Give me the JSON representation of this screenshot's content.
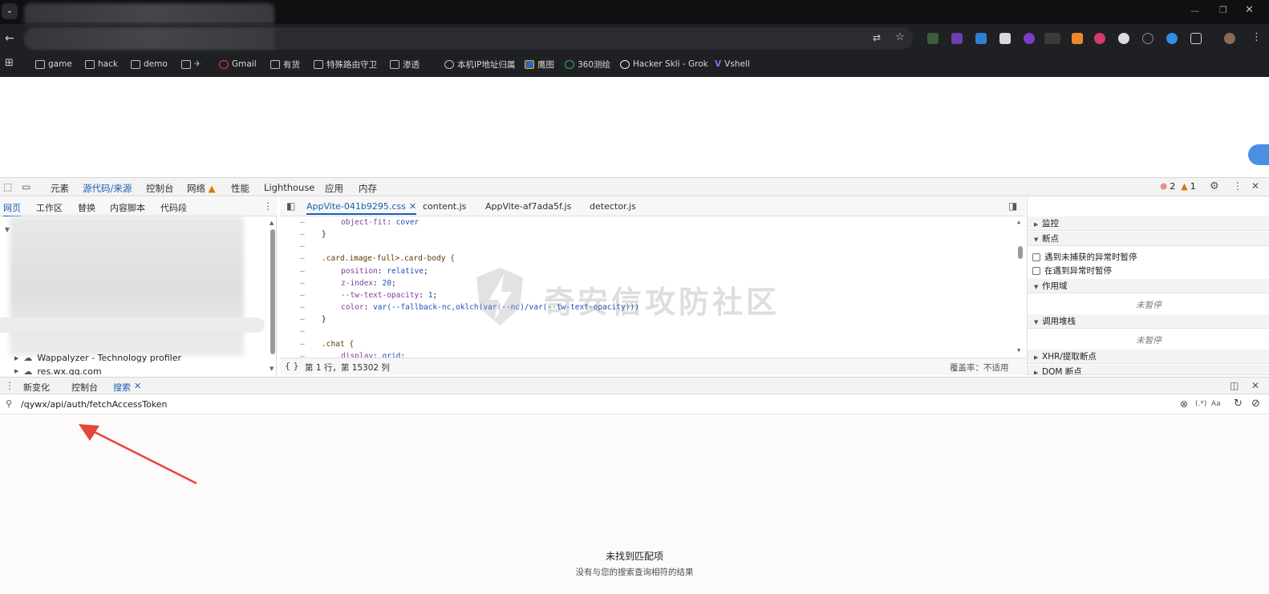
{
  "bookmarks": [
    {
      "label": "game",
      "icon": "folder-icon"
    },
    {
      "label": "hack",
      "icon": "folder-icon"
    },
    {
      "label": "demo",
      "icon": "folder-icon"
    },
    {
      "label": "",
      "icon": "folder-icon"
    },
    {
      "label": "Gmail",
      "icon": "google-icon"
    },
    {
      "label": "有货",
      "icon": "folder-icon"
    },
    {
      "label": "特殊路由守卫",
      "icon": "folder-icon"
    },
    {
      "label": "渗透",
      "icon": "folder-icon"
    },
    {
      "label": "本机IP地址归属",
      "icon": "globe-icon"
    },
    {
      "label": "鹰图",
      "icon": "hunter-icon"
    },
    {
      "label": "360测绘",
      "icon": "360-icon"
    },
    {
      "label": "Hacker Skli - Grok",
      "icon": "grok-icon"
    },
    {
      "label": "Vshell",
      "icon": "vshell-icon"
    }
  ],
  "devtools": {
    "main_tabs": [
      "元素",
      "源代码/来源",
      "控制台",
      "网络",
      "性能",
      "Lighthouse",
      "应用",
      "内存"
    ],
    "active_main_tab": "源代码/来源",
    "errors": "2",
    "warnings": "1",
    "nav_tabs": [
      "网页",
      "工作区",
      "替换",
      "内容脚本",
      "代码段"
    ],
    "tree_items": [
      "Wappalyzer - Technology profiler",
      "res.wx.qq.com"
    ],
    "file_tabs": [
      "AppVite-041b9295.css",
      "content.js",
      "AppVite-af7ada5f.js",
      "detector.js"
    ],
    "active_file_tab": "AppVite-041b9295.css",
    "code_lines": [
      "object-fit: cover",
      "}",
      "",
      ".card.image-full>.card-body {",
      "position: relative;",
      "z-index: 20;",
      "--tw-text-opacity: 1;",
      "color: var(--fallback-nc,oklch(var(--nc)/var(--tw-text-opacity)))",
      "}",
      "",
      ".chat {",
      "display: grid;"
    ],
    "status_position": "第 1 行，第 15302 列",
    "status_coverage": "覆盖率：不适用",
    "debugger_sections": {
      "watch": "监控",
      "breakpoints": "断点",
      "pause_uncaught": "遇到未捕获的异常时暂停",
      "pause_caught": "在遇到异常时暂停",
      "scope": "作用域",
      "scope_empty": "未暂停",
      "callstack": "调用堆栈",
      "callstack_empty": "未暂停",
      "xhr": "XHR/提取断点",
      "dom": "DOM 断点"
    },
    "drawer_tabs": [
      "新变化",
      "控制台",
      "搜索"
    ],
    "active_drawer_tab": "搜索",
    "search_query": "/qywx/api/auth/fetchAccessToken",
    "search_regex_label": "(.*)",
    "search_case_label": "Aa",
    "no_match_title": "未找到匹配项",
    "no_match_subtitle": "没有与您的搜索查询相符的结果"
  },
  "watermark_text": "奇安信攻防社区",
  "colors": {
    "accent": "#1a5fb4",
    "error": "#d93025",
    "warning": "#e37400",
    "annotation_arrow": "#e8453c"
  }
}
